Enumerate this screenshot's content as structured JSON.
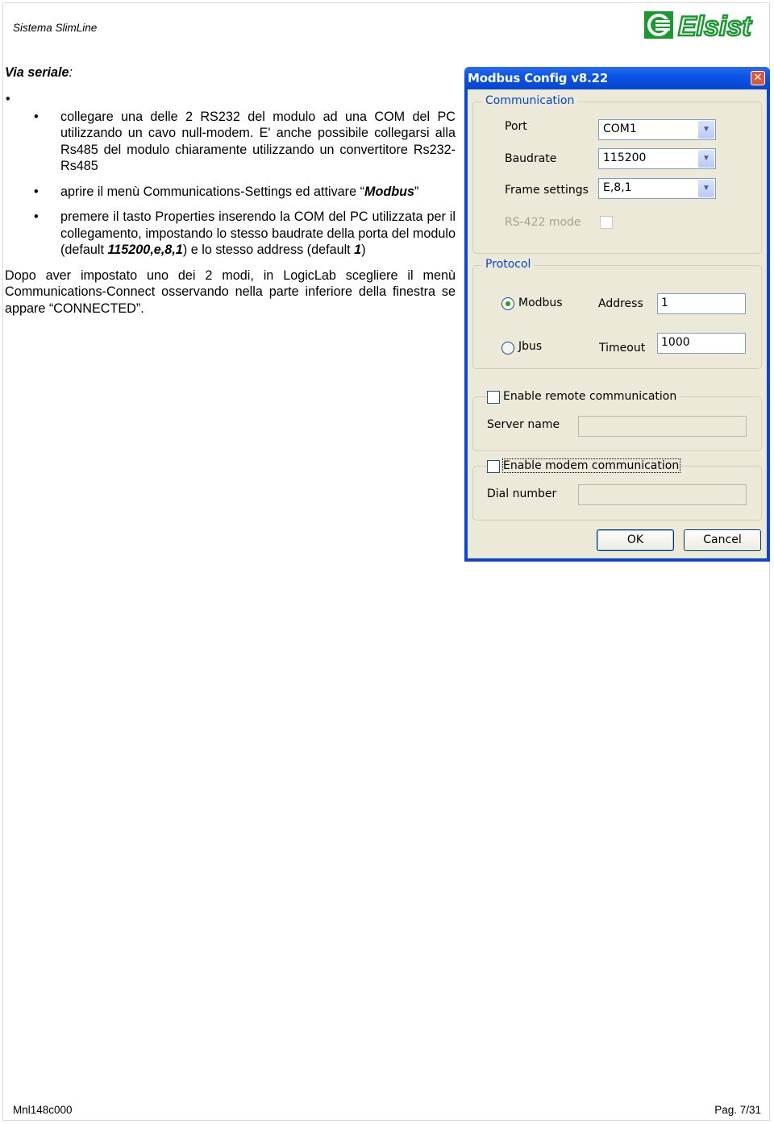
{
  "header": {
    "title": "Sistema SlimLine",
    "logo_text": "Elsist",
    "logo_color": "#1a9a2e"
  },
  "content": {
    "section_title": "Via seriale",
    "section_title_suffix": ":",
    "lone_bullet": "•",
    "bullets": [
      {
        "text": "collegare una delle 2 RS232 del modulo ad una COM del PC utilizzando un cavo null-modem. E' anche possibile collegarsi alla Rs485 del modulo chiaramente utilizzando un convertitore Rs232-Rs485"
      },
      {
        "text_before": "aprire il menù Communications-Settings ed attivare “",
        "emphasis": "Modbus",
        "text_after": "”"
      },
      {
        "text_before": "premere il tasto Properties inserendo la COM del PC utilizzata per il collegamento, impostando lo stesso baudrate della porta del modulo (default ",
        "emphasis_1": "115200,e,8,1",
        "text_middle": ") e lo stesso address (default ",
        "emphasis_2": "1",
        "text_after": ")"
      }
    ],
    "closing": "Dopo aver impostato uno dei 2 modi, in LogicLab scegliere il menù Communications-Connect osservando nella parte inferiore della finestra se appare “CONNECTED”."
  },
  "dialog": {
    "title": "Modbus Config v8.22",
    "close_glyph": "✕",
    "communication": {
      "legend": "Communication",
      "port_label": "Port",
      "port_value": "COM1",
      "baudrate_label": "Baudrate",
      "baudrate_value": "115200",
      "frame_label": "Frame settings",
      "frame_value": "E,8,1",
      "rs422_label": "RS-422 mode",
      "rs422_checked": false
    },
    "protocol": {
      "legend": "Protocol",
      "modbus_label": "Modbus",
      "modbus_selected": true,
      "jbus_label": "Jbus",
      "jbus_selected": false,
      "address_label": "Address",
      "address_value": "1",
      "timeout_label": "Timeout",
      "timeout_value": "1000"
    },
    "remote": {
      "checkbox_label": "Enable remote communication",
      "checked": false,
      "server_label": "Server name",
      "server_value": ""
    },
    "modem": {
      "checkbox_label": "Enable modem communication",
      "checked": false,
      "dial_label": "Dial number",
      "dial_value": ""
    },
    "ok_label": "OK",
    "cancel_label": "Cancel",
    "combo_arrow_glyph": "▼"
  },
  "footer": {
    "doc_code": "Mnl148c000",
    "page": "Pag. 7/31"
  }
}
